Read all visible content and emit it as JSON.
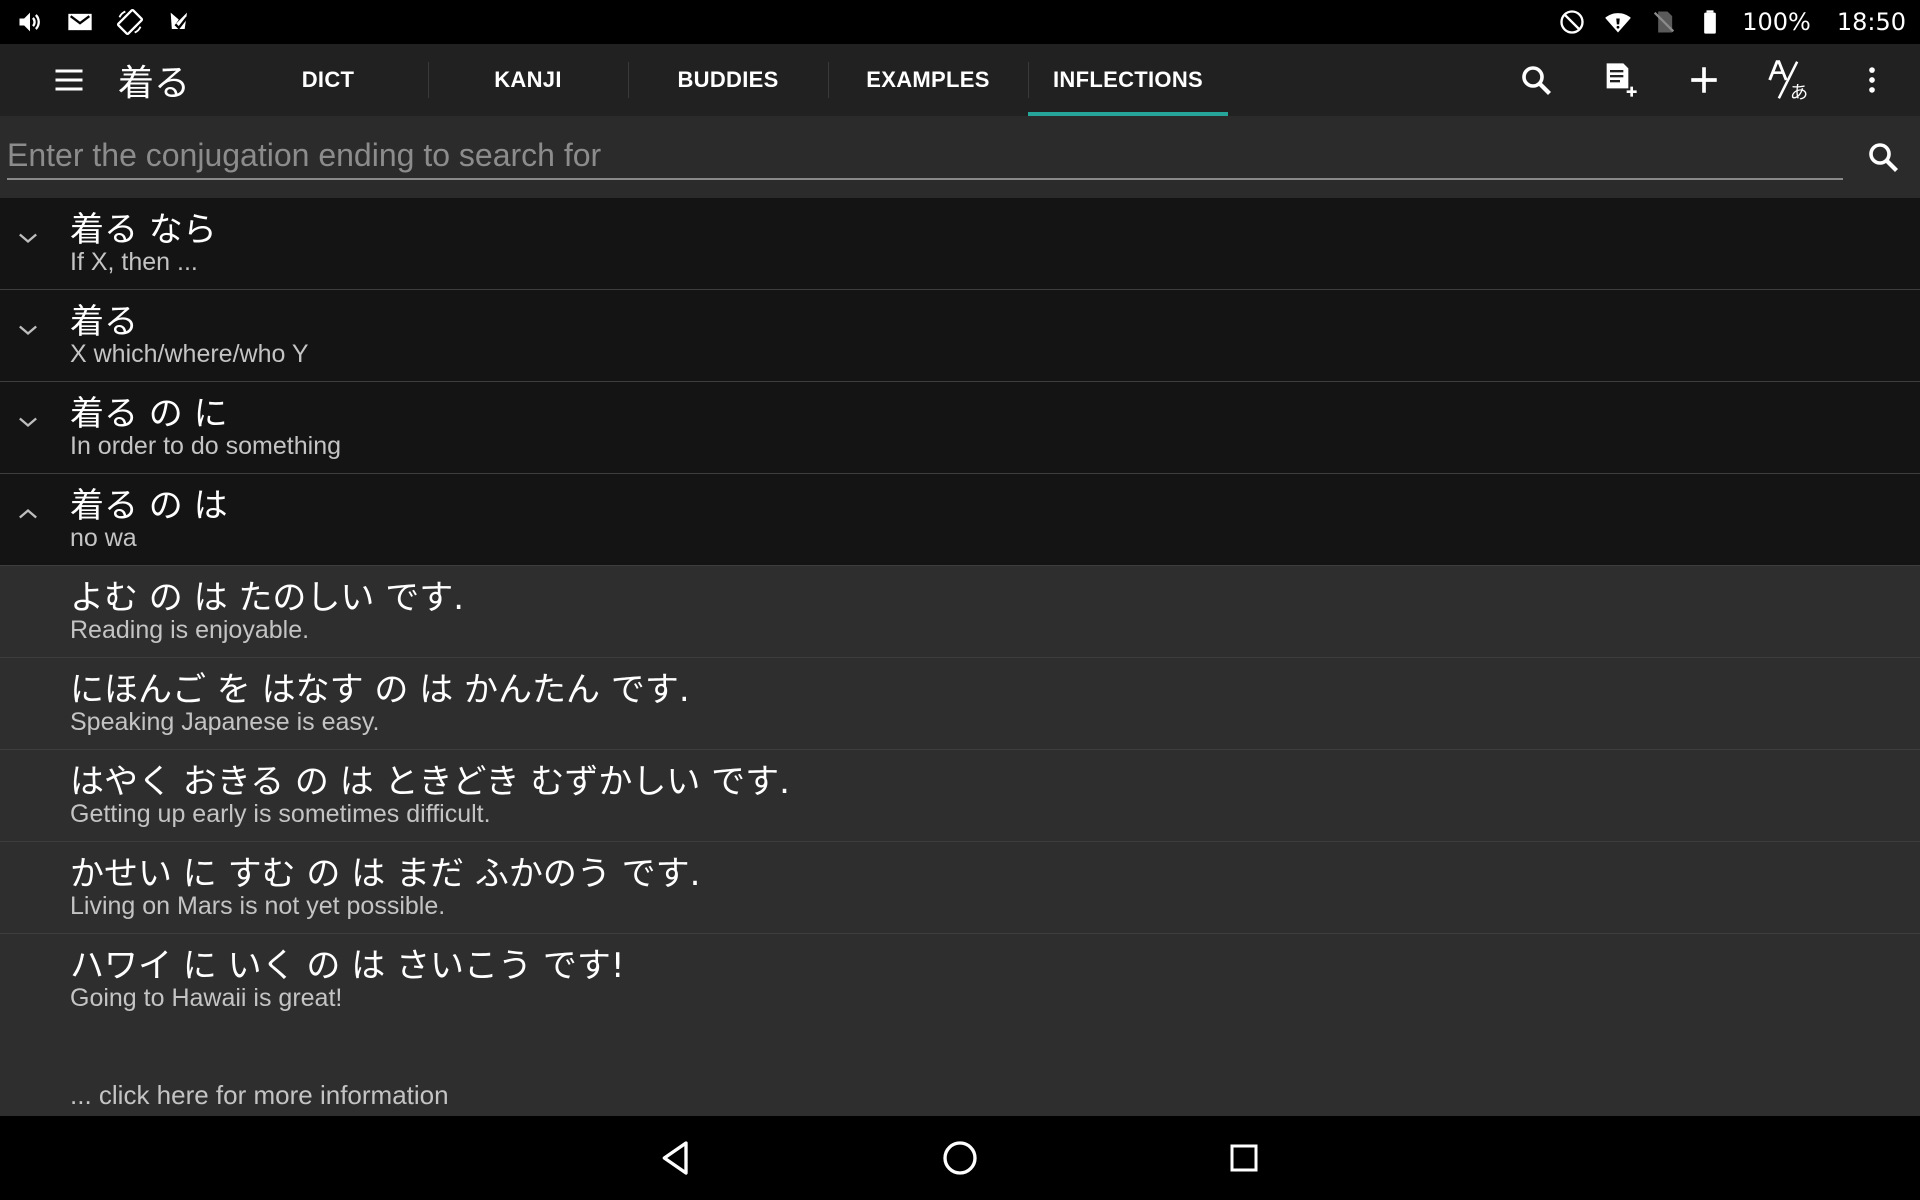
{
  "status_bar": {
    "battery": "100%",
    "time": "18:50",
    "left_icons": [
      "volume-icon",
      "gmail-icon",
      "screen-rotation-icon",
      "app-notification-icon"
    ],
    "right_icons": [
      "do-not-disturb-icon",
      "wifi-icon",
      "no-sim-icon",
      "battery-icon"
    ]
  },
  "app_bar": {
    "title": "着る",
    "tabs": [
      {
        "label": "DICT",
        "active": false
      },
      {
        "label": "KANJI",
        "active": false
      },
      {
        "label": "BUDDIES",
        "active": false
      },
      {
        "label": "EXAMPLES",
        "active": false
      },
      {
        "label": "INFLECTIONS",
        "active": true
      }
    ],
    "actions": [
      "search-icon",
      "add-note-icon",
      "plus-icon",
      "translate-icon",
      "more-vert-icon"
    ],
    "accent_color": "#26a69a"
  },
  "search": {
    "value": "",
    "placeholder": "Enter the conjugation ending to search for"
  },
  "groups": [
    {
      "main": "着る なら",
      "sub": "If X, then ...",
      "expanded": false
    },
    {
      "main": "着る",
      "sub": "X which/where/who Y",
      "expanded": false
    },
    {
      "main": "着る の に",
      "sub": "In order to do something",
      "expanded": false
    },
    {
      "main": "着る の は",
      "sub": "no wa",
      "expanded": true
    }
  ],
  "examples": [
    {
      "jp": "よむ の は たのしい です.",
      "en": "Reading is enjoyable."
    },
    {
      "jp": "にほんご を はなす の は かんたん です.",
      "en": "Speaking Japanese is easy."
    },
    {
      "jp": "はやく おきる の は ときどき むずかしい です.",
      "en": "Getting up early is sometimes difficult."
    },
    {
      "jp": "かせい に すむ の は まだ ふかのう です.",
      "en": "Living on Mars is not yet possible."
    },
    {
      "jp": "ハワイ に いく の は さいこう です!",
      "en": "Going to Hawaii is great!"
    }
  ],
  "more_info": "... click here for more information",
  "nav_bar": [
    "back-icon",
    "home-icon",
    "recents-icon"
  ]
}
